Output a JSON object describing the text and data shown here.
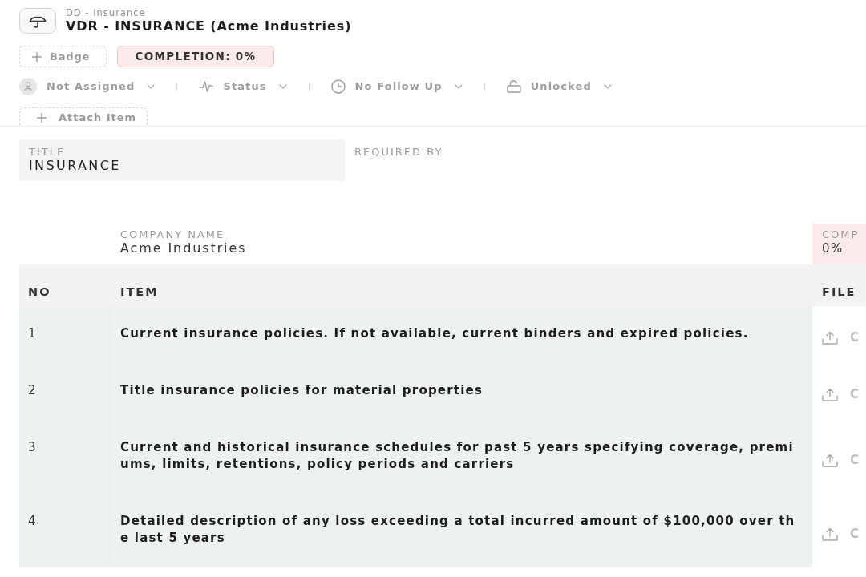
{
  "header": {
    "breadcrumb": "DD - Insurance",
    "title": "VDR - INSURANCE (Acme Industries)"
  },
  "badges": [
    {
      "kind": "add",
      "label": "Badge"
    },
    {
      "kind": "completion",
      "label": "COMPLETION: 0%"
    }
  ],
  "meta": [
    {
      "kind": "assignee",
      "label": "Not Assigned"
    },
    {
      "kind": "status",
      "label": "Status"
    },
    {
      "kind": "follow_up",
      "label": "No Follow Up"
    },
    {
      "kind": "lock",
      "label": "Unlocked"
    }
  ],
  "attach_button": {
    "label": "Attach Item"
  },
  "fields": [
    {
      "label": "TITLE",
      "value": "INSURANCE"
    },
    {
      "label": "REQUIRED BY"
    }
  ],
  "table": {
    "company": {
      "label": "COMPANY NAME",
      "value": "Acme Industries"
    },
    "completion": {
      "label": "COMP",
      "value": "0%"
    },
    "columns": [
      "NO",
      "ITEM",
      "FILE"
    ],
    "rows": [
      {
        "no": "1",
        "item": "Current insurance policies. If not available, current binders and expired policies.",
        "file": "C"
      },
      {
        "no": "2",
        "item": "Title insurance policies for material properties",
        "file": "C"
      },
      {
        "no": "3",
        "item": "Current and historical insurance schedules for past 5 years specifying coverage, premiums, limits, retentions, policy periods and carriers",
        "file": "C"
      },
      {
        "no": "4",
        "item": "Detailed description of any loss exceeding a total incurred amount of $100,000 over the last 5 years",
        "file": "C"
      }
    ]
  }
}
